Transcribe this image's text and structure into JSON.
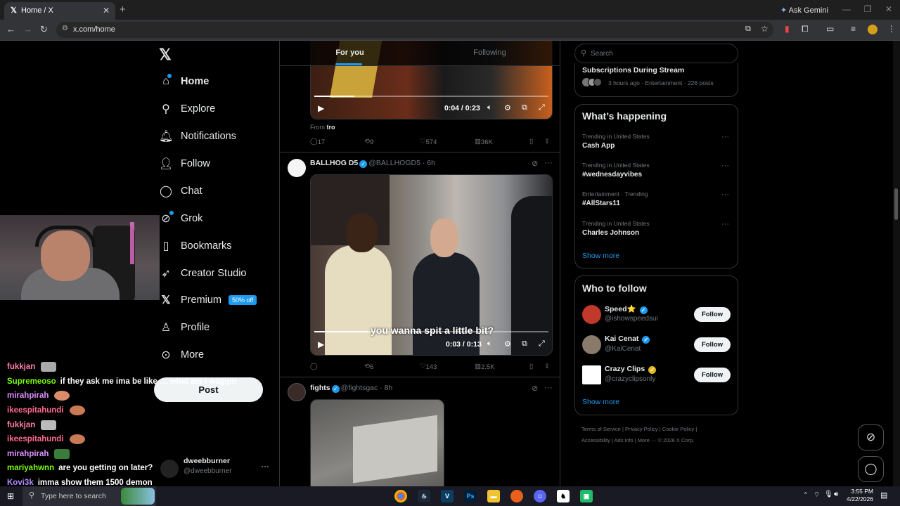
{
  "browser": {
    "tab_title": "Home / X",
    "address": "x.com/home",
    "gemini_label": "Ask Gemini"
  },
  "nav": {
    "items": [
      "Home",
      "Explore",
      "Notifications",
      "Follow",
      "Chat",
      "Grok",
      "Bookmarks",
      "Creator Studio",
      "Premium",
      "Profile",
      "More"
    ],
    "premium_badge": "50% off",
    "post_label": "Post",
    "account_name": "dweebburner",
    "account_handle": "@dweebburner"
  },
  "tabs": {
    "for_you": "For you",
    "following": "Following"
  },
  "tweet1": {
    "time": "0:04 / 0:23",
    "from_label": "From",
    "from_source": "tro",
    "replies": "17",
    "reposts": "9",
    "likes": "574",
    "views": "36K"
  },
  "tweet2": {
    "name": "BALLHOG D5",
    "handle": "@BALLHOGD5 · 6h",
    "caption": "you wanna spit a little bit?",
    "time": "0:03 / 0:13",
    "replies": "",
    "reposts": "6",
    "likes": "143",
    "views": "2.5K"
  },
  "tweet3": {
    "name": "fights",
    "handle": "@fightsgac · 8h"
  },
  "right": {
    "search_placeholder": "Search",
    "top_card_title": "Subscriptions During Stream",
    "top_card_meta": "3 hours ago · Entertainment · 226 posts",
    "happening_title": "What’s happening",
    "trends": [
      {
        "context": "Trending in United States",
        "name": "Cash App"
      },
      {
        "context": "Trending in United States",
        "name": "#wednesdayvibes"
      },
      {
        "context": "Entertainment · Trending",
        "name": "#AllStars11"
      },
      {
        "context": "Trending in United States",
        "name": "Charles Johnson"
      }
    ],
    "show_more": "Show more",
    "wtf_title": "Who to follow",
    "wtf": [
      {
        "name": "Speed⭐",
        "handle": "@ishowspeedsui"
      },
      {
        "name": "Kai Cenat",
        "handle": "@KaiCenat"
      },
      {
        "name": "Crazy Clips",
        "handle": "@crazyclipsonly"
      }
    ],
    "follow_label": "Follow",
    "footer": [
      "Terms of Service",
      "Privacy Policy",
      "Cookie Policy",
      "Accessibility",
      "Ads info",
      "More ···",
      "© 2026 X Corp."
    ]
  },
  "chat": [
    {
      "user": "fukkjan",
      "msg": "",
      "color": "#ff7fa8"
    },
    {
      "user": "Supremeoso",
      "msg": "if they ask me ima be like … what am i waggin",
      "color": "#7cfc00"
    },
    {
      "user": "mirahpirah",
      "msg": "",
      "color": "#e08fff"
    },
    {
      "user": "ikeespitahundi",
      "msg": "",
      "color": "#ff6a8e"
    },
    {
      "user": "fukkjan",
      "msg": "",
      "color": "#ff7fa8"
    },
    {
      "user": "ikeespitahundi",
      "msg": "",
      "color": "#ff6a8e"
    },
    {
      "user": "mirahpirah",
      "msg": "",
      "color": "#e08fff"
    },
    {
      "user": "mariyahwnn",
      "msg": "are you getting on later?",
      "color": "#7cfc00"
    },
    {
      "user": "Kovi3k",
      "msg": "imma show them 1500 demon",
      "color": "#b28cff"
    }
  ],
  "taskbar": {
    "search_placeholder": "Type here to search",
    "time": "3:55 PM",
    "date": "4/22/2026"
  }
}
